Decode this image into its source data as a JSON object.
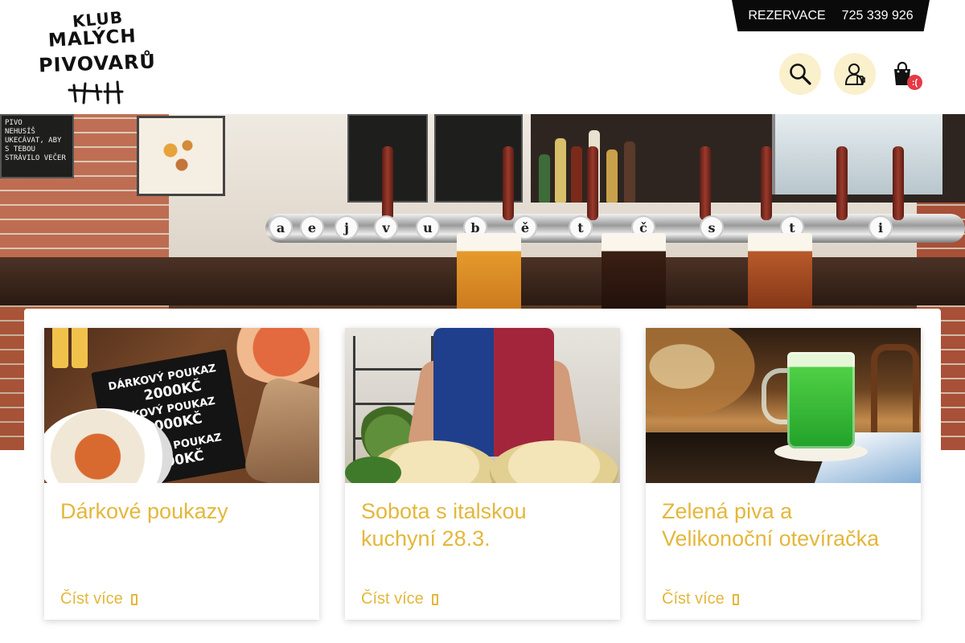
{
  "header": {
    "logo": {
      "line1": "KLUB",
      "line2": "MALÝCH",
      "line3": "PIVOVARŮ"
    },
    "contact": {
      "reservation_label": "REZERVACE",
      "phone": "725 339 926"
    },
    "icons": {
      "search": "search-icon",
      "account": "account-icon",
      "cart": "shopping-bag-icon"
    },
    "cart_badge": ":("
  },
  "hero": {
    "chalkboard_left": "PIVO\nNEHUSÍŠ\nUKECÁVAT, ABY\nS TEBOU\nSTRÁVILO VEČER",
    "tap_letters": [
      "a",
      "e",
      "j",
      "v",
      "u",
      "b",
      "ě",
      "t",
      "č",
      "s",
      "t",
      "i"
    ]
  },
  "articles": [
    {
      "title": "Dárkové poukazy",
      "more_label": "Číst více",
      "image": {
        "voucher_lines": [
          "DÁRKOVÝ POUKAZ",
          "2000KČ",
          "DÁRKOVÝ POUKAZ",
          "1000KČ",
          "DÁRKOVÝ POUKAZ",
          "500KČ"
        ]
      }
    },
    {
      "title": "Sobota s italskou kuchyní 28.3.",
      "more_label": "Číst více"
    },
    {
      "title": "Zelená piva a Velikonoční otevíračka",
      "more_label": "Číst více"
    }
  ],
  "colors": {
    "accent": "#e4b73b",
    "icon_circle": "#fbf0cc",
    "badge": "#e63946",
    "contact_bg": "#0a0a0a"
  }
}
